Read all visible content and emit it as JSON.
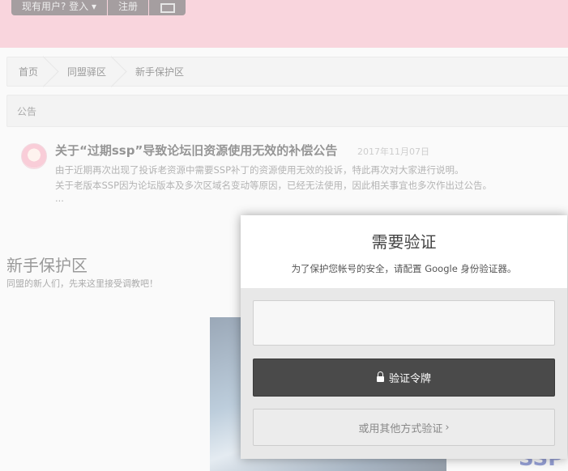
{
  "header": {
    "login_label": "现有用户? 登入 ▾",
    "register_label": "注册",
    "image_icon": "image-icon"
  },
  "breadcrumb": [
    "首页",
    "同盟驿区",
    "新手保护区"
  ],
  "announcements": {
    "label": "公告",
    "item": {
      "title": "关于“过期ssp”导致论坛旧资源使用无效的补偿公告",
      "date": "2017年11月07日",
      "lines": [
        "由于近期再次出现了投诉老资源中需要SSP补丁的资源使用无效的投诉，特此再次对大家进行说明。",
        "关于老版本SSP因为论坛版本及多次区域名变动等原因，已经无法使用，因此相关事宜也多次作出过公告。",
        "..."
      ]
    }
  },
  "forum": {
    "title": "新手保护区",
    "description": "同盟的新人们，先来这里接受调教吧！",
    "corner_text": "SSP"
  },
  "modal": {
    "title": "需要验证",
    "subtitle": "为了保护您帐号的安全，请配置 Google 身份验证器。",
    "token_placeholder": "",
    "verify_label": "验证令牌",
    "alt_label": "或用其他方式验证",
    "alt_chevron": "›"
  },
  "colors": {
    "header_bg": "#f2aabb",
    "verify_button_bg": "#4a4a4a",
    "ssp_mark": "#2b3ea8"
  }
}
